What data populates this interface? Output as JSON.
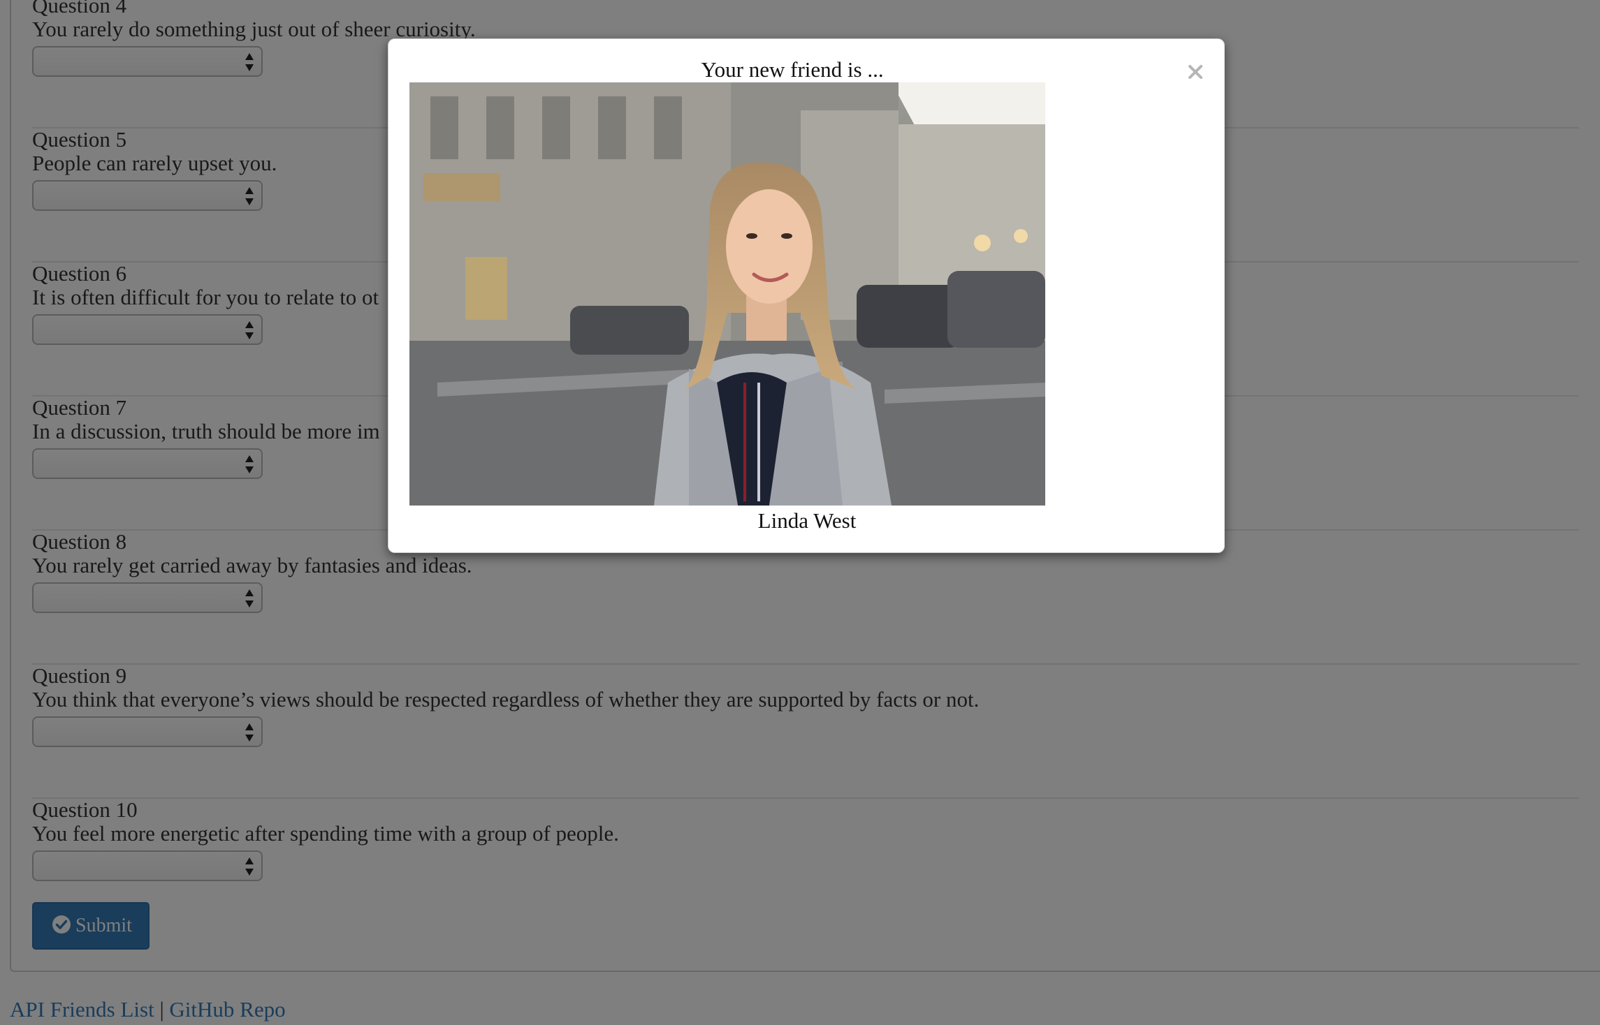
{
  "questions": [
    {
      "title": "Question 4",
      "text": "You rarely do something just out of sheer curiosity."
    },
    {
      "title": "Question 5",
      "text": "People can rarely upset you."
    },
    {
      "title": "Question 6",
      "text": "It is often difficult for you to relate to ot"
    },
    {
      "title": "Question 7",
      "text": "In a discussion, truth should be more im"
    },
    {
      "title": "Question 8",
      "text": "You rarely get carried away by fantasies and ideas."
    },
    {
      "title": "Question 9",
      "text": "You think that everyone’s views should be respected regardless of whether they are supported by facts or not."
    },
    {
      "title": "Question 10",
      "text": "You feel more energetic after spending time with a group of people."
    }
  ],
  "submit": {
    "label": "Submit",
    "icon": "check-circle-icon"
  },
  "footer": {
    "api_link": "API Friends List",
    "separator": "|",
    "repo_link": "GitHub Repo"
  },
  "modal": {
    "title": "Your new friend is ...",
    "close_symbol": "×",
    "photo_icon": "friend-photo",
    "friend_name": "Linda West"
  },
  "colors": {
    "accent": "#337ab7",
    "overlay": "rgba(0,0,0,0.5)",
    "text": "#333333",
    "close": "#b5b5b5"
  }
}
